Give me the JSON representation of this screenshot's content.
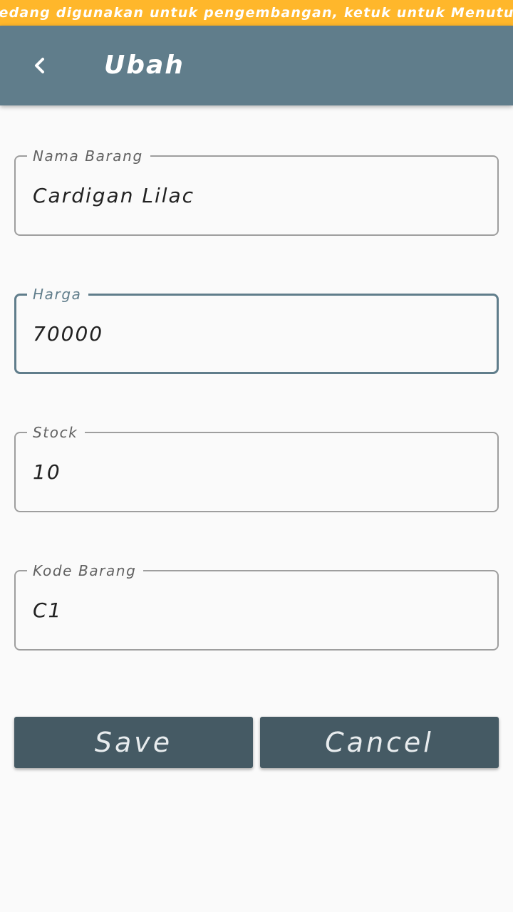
{
  "dev_banner": {
    "text": "Sedang digunakan untuk pengembangan, ketuk untuk Menutup"
  },
  "app_bar": {
    "title": "Ubah",
    "back_icon": "chevron-left-icon"
  },
  "form": {
    "fields": [
      {
        "label": "Nama Barang",
        "value": "Cardigan Lilac"
      },
      {
        "label": "Harga",
        "value": "70000"
      },
      {
        "label": "Stock",
        "value": "10"
      },
      {
        "label": "Kode Barang",
        "value": "C1"
      }
    ]
  },
  "actions": {
    "save_label": "Save",
    "cancel_label": "Cancel"
  },
  "colors": {
    "banner": "#ffb72b",
    "app_bar": "#607d8b",
    "button": "#455a64",
    "focused_border": "#607d8b"
  }
}
